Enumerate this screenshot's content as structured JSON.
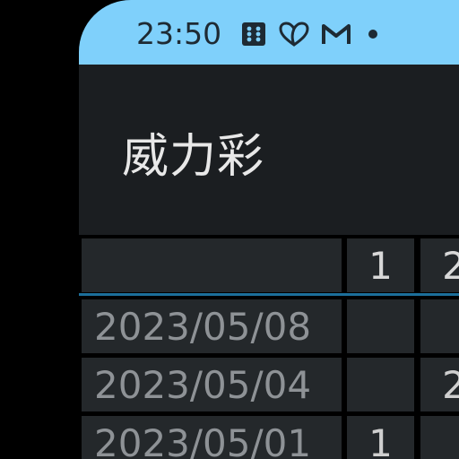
{
  "status_bar": {
    "time": "23:50",
    "icons": [
      "grid-notification-icon",
      "fitness-heart-icon",
      "gmail-icon",
      "dot-indicator-icon"
    ],
    "background_color": "#7fd0fb"
  },
  "app_bar": {
    "title": "威力彩"
  },
  "table": {
    "columns": [
      "",
      "1",
      "2"
    ],
    "rows": [
      {
        "date": "2023/05/08",
        "c1": "",
        "c2": ""
      },
      {
        "date": "2023/05/04",
        "c1": "",
        "c2": "2"
      },
      {
        "date": "2023/05/01",
        "c1": "1",
        "c2": ""
      }
    ],
    "accent_color": "#1c6f9a"
  }
}
